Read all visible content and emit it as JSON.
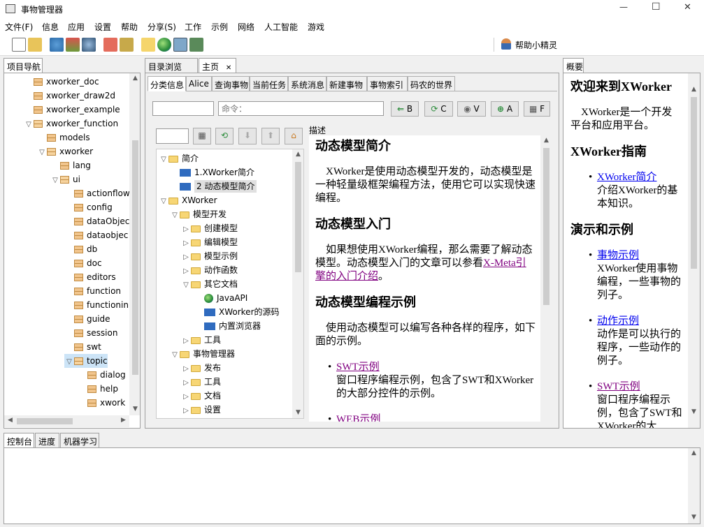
{
  "window": {
    "title": "事物管理器",
    "minimize": "—",
    "maximize": "☐",
    "close": "✕"
  },
  "menu": [
    "文件(F)",
    "信息",
    "应用",
    "设置",
    "帮助",
    "分享(S)",
    "工作",
    "示例",
    "网络",
    "人工智能",
    "游戏"
  ],
  "toolbar": {
    "helper_label": "帮助小精灵"
  },
  "left_panel": {
    "tab": "项目导航",
    "tree": [
      {
        "label": "xworker_doc"
      },
      {
        "label": "xworker_draw2d"
      },
      {
        "label": "xworker_example"
      },
      {
        "label": "xworker_function"
      },
      {
        "label": "models"
      },
      {
        "label": "xworker"
      },
      {
        "label": "lang"
      },
      {
        "label": "ui"
      },
      {
        "label": "actionflow"
      },
      {
        "label": "config"
      },
      {
        "label": "dataObjec"
      },
      {
        "label": "dataobjec"
      },
      {
        "label": "db"
      },
      {
        "label": "doc"
      },
      {
        "label": "editors"
      },
      {
        "label": "function"
      },
      {
        "label": "functionin"
      },
      {
        "label": "guide"
      },
      {
        "label": "session"
      },
      {
        "label": "swt"
      },
      {
        "label": "topic"
      },
      {
        "label": "dialog"
      },
      {
        "label": "help"
      },
      {
        "label": "xwork"
      }
    ]
  },
  "center": {
    "tabs": {
      "browse": "目录浏览",
      "home": "主页",
      "home_close": "✕"
    },
    "subtabs": [
      "分类信息",
      "Alice",
      "查询事物",
      "当前任务",
      "系统消息",
      "新建事物",
      "事物索引",
      "码农的世界"
    ],
    "command_placeholder": "命令：",
    "buttons": {
      "b": "B",
      "c": "C",
      "v": "V",
      "a": "A",
      "f": "F"
    },
    "desc_label": "描述",
    "tree": [
      {
        "label": "简介"
      },
      {
        "label": "1.XWorker简介"
      },
      {
        "label": "2 动态模型简介"
      },
      {
        "label": "XWorker"
      },
      {
        "label": "模型开发"
      },
      {
        "label": "创建模型"
      },
      {
        "label": "编辑模型"
      },
      {
        "label": "模型示例"
      },
      {
        "label": "动作函数"
      },
      {
        "label": "其它文档"
      },
      {
        "label": "JavaAPI"
      },
      {
        "label": "XWorker的源码"
      },
      {
        "label": "内置浏览器"
      },
      {
        "label": "工具"
      },
      {
        "label": "事物管理器"
      },
      {
        "label": "发布"
      },
      {
        "label": "工具"
      },
      {
        "label": "文档"
      },
      {
        "label": "设置"
      }
    ],
    "doc": {
      "h1": "动态模型简介",
      "p1": "XWorker是使用动态模型开发的，动态模型是一种轻量级框架编程方法，使用它可以实现快速编程。",
      "h2": "动态模型入门",
      "p2_a": "如果想使用XWorker编程，那么需要了解动态模型。动态模型入门的文章可以参看",
      "p2_link": "X-Meta引擎的入门介绍",
      "p2_b": "。",
      "h3": "动态模型编程示例",
      "p3": "使用动态模型可以编写各种各样的程序，如下面的示例。",
      "li1_link": "SWT示例",
      "li1_text": "窗口程序编程示例，包含了SWT和XWorker的大部分控件的示例。",
      "li2_link": "WEB示例"
    }
  },
  "right_panel": {
    "tab": "概要",
    "h_welcome": "欢迎来到XWorker",
    "p_welcome": "XWorker是一个开发平台和应用平台。",
    "h_guide": "XWorker指南",
    "guide_link": "XWorker简介",
    "guide_text": "介绍XWorker的基本知识。",
    "h_demo": "演示和示例",
    "demo1_link": "事物示例",
    "demo1_text": "XWorker使用事物编程，一些事物的列子。",
    "demo2_link": "动作示例",
    "demo2_text": "动作是可以执行的程序，一些动作的例子。",
    "demo3_link": "SWT示例",
    "demo3_text": "窗口程序编程示例，包含了SWT和XWorker的大"
  },
  "bottom": {
    "tabs": [
      "控制台",
      "进度",
      "机器学习"
    ]
  }
}
